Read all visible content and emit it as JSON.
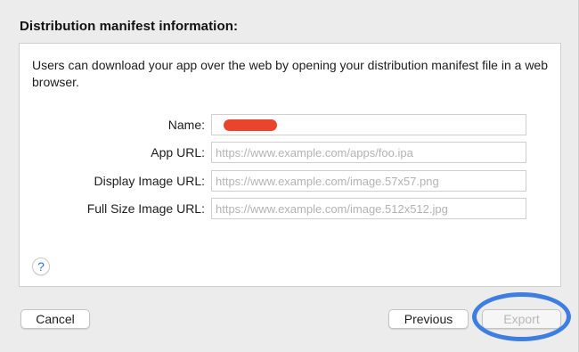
{
  "section": {
    "title": "Distribution manifest information:"
  },
  "panel": {
    "description": "Users can download your app over the web by opening your distribution manifest file in a web browser."
  },
  "form": {
    "fields": [
      {
        "label": "Name:",
        "value": "",
        "placeholder": "",
        "redacted": true
      },
      {
        "label": "App URL:",
        "value": "",
        "placeholder": "https://www.example.com/apps/foo.ipa"
      },
      {
        "label": "Display Image URL:",
        "value": "",
        "placeholder": "https://www.example.com/image.57x57.png"
      },
      {
        "label": "Full Size Image URL:",
        "value": "",
        "placeholder": "https://www.example.com/image.512x512.jpg"
      }
    ]
  },
  "help": {
    "label": "?"
  },
  "buttons": {
    "cancel": "Cancel",
    "previous": "Previous",
    "export": "Export"
  },
  "colors": {
    "highlight_ring": "#3d7ee0",
    "redaction": "#e8452c",
    "help_glyph": "#2d6ff0"
  }
}
